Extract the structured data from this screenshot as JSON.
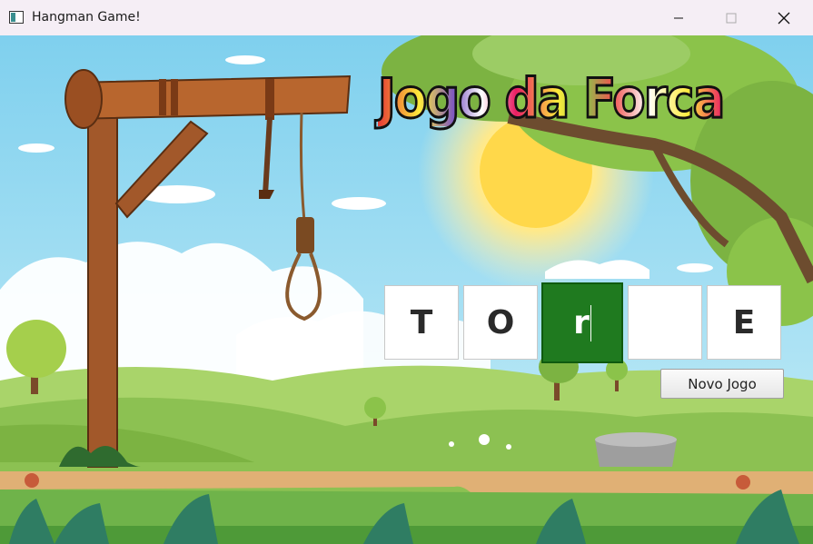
{
  "window": {
    "title": "Hangman Game!",
    "controls": [
      "minimize-icon",
      "maximize-icon",
      "close-icon"
    ]
  },
  "game": {
    "title": "Jogo da Forca",
    "letters": [
      "T",
      "O",
      "r",
      "",
      "E"
    ],
    "active_index": 2,
    "new_game_label": "Novo Jogo"
  },
  "colors": {
    "active_letter_bg": "#1f7a1f",
    "titlebar_bg": "#f5eef5"
  }
}
